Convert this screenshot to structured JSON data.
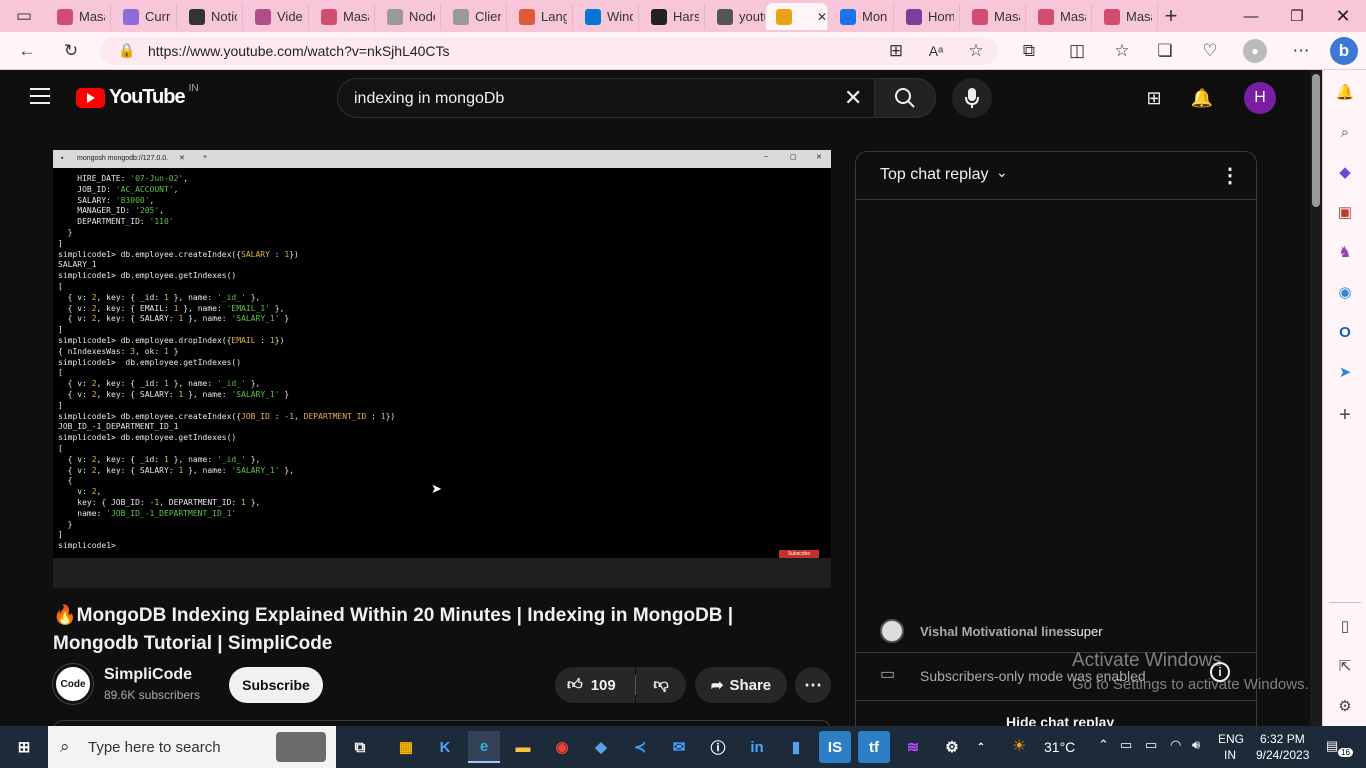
{
  "browser": {
    "tabs": [
      {
        "label": "Masa",
        "icon": "document-icon",
        "color": "#d14d72"
      },
      {
        "label": "Curri",
        "icon": "puzzle-icon",
        "color": "#8e6bd8"
      },
      {
        "label": "Notic",
        "icon": "notion-icon",
        "color": "#333333"
      },
      {
        "label": "Vide",
        "icon": "video-icon",
        "color": "#b04d8a"
      },
      {
        "label": "Masa",
        "icon": "document-icon",
        "color": "#d14d72"
      },
      {
        "label": "Node",
        "icon": "node-icon",
        "color": "#999999"
      },
      {
        "label": "Clien",
        "icon": "client-icon",
        "color": "#999999"
      },
      {
        "label": "Lang",
        "icon": "language-icon",
        "color": "#e05a3a"
      },
      {
        "label": "Wind",
        "icon": "windows-icon",
        "color": "#0078d4"
      },
      {
        "label": "Harsh",
        "icon": "github-icon",
        "color": "#222222"
      },
      {
        "label": "youtu",
        "icon": "search-icon",
        "color": "#555555"
      },
      {
        "label": "",
        "icon": "speaker-icon",
        "color": "#e8a317"
      },
      {
        "label": "Mon",
        "icon": "mongo-icon",
        "color": "#1a73e8"
      },
      {
        "label": "Hom",
        "icon": "home-icon",
        "color": "#7b3fa0"
      },
      {
        "label": "Masa",
        "icon": "document-icon",
        "color": "#d14d72"
      },
      {
        "label": "Masa",
        "icon": "document-icon",
        "color": "#d14d72"
      },
      {
        "label": "Masa",
        "icon": "document-icon",
        "color": "#d14d72"
      }
    ],
    "url": "https://www.youtube.com/watch?v=nkSjhL40CTs"
  },
  "youtube": {
    "logo_text": "YouTube",
    "country": "IN",
    "search_query": "indexing in mongoDb",
    "avatar_letter": "H",
    "terminal_title": "mongosh mongodb://127.0.0.",
    "video_title": "🔥MongoDB Indexing Explained Within 20 Minutes | Indexing in MongoDB | Mongodb Tutorial | SimpliCode",
    "channel_name": "SimpliCode",
    "channel_logo": "Code",
    "subscribers": "89.6K subscribers",
    "subscribe_label": "Subscribe",
    "likes": "109",
    "share_label": "Share",
    "subscribe_badge": "Subscribe"
  },
  "chat": {
    "header": "Top chat replay",
    "message_author": "Vishal Motivational lines",
    "message_text": "super",
    "subscribers_only": "Subscribers-only mode was enabled",
    "hide_label": "Hide chat replay"
  },
  "watermark": {
    "line1": "Activate Windows",
    "line2": "Go to Settings to activate Windows."
  },
  "taskbar": {
    "search_placeholder": "Type here to search",
    "temperature": "31°C",
    "language": "ENG",
    "region": "IN",
    "time": "6:32 PM",
    "date": "9/24/2023",
    "notifications": "16"
  }
}
